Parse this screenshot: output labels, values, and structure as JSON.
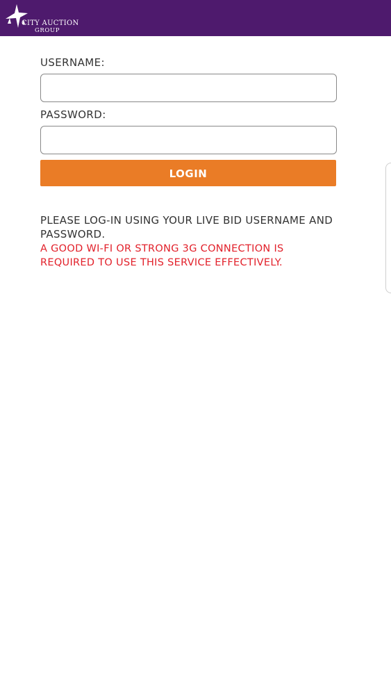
{
  "header": {
    "logo": {
      "line1": "CITY AUCTION",
      "line2": "GROUP",
      "icon": "star-burst-icon"
    }
  },
  "login_form": {
    "username_label": "USERNAME:",
    "username_value": "",
    "password_label": "PASSWORD:",
    "password_value": "",
    "login_label": "LOGIN"
  },
  "messages": {
    "info": "PLEASE LOG-IN USING YOUR LIVE BID USERNAME AND PASSWORD.",
    "warning": "A GOOD WI-FI OR STRONG 3G CONNECTION IS REQUIRED TO USE THIS SERVICE EFFECTIVELY."
  },
  "colors": {
    "header_bg": "#4e1a6d",
    "button_bg": "#ea7c26",
    "warning_text": "#e2202a"
  }
}
